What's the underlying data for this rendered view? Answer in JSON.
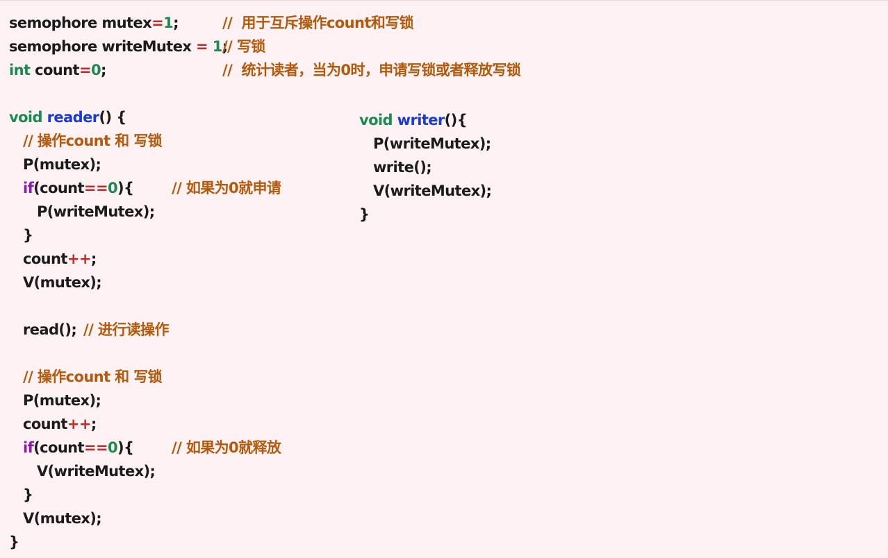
{
  "code": {
    "decl": {
      "mutex": {
        "type": "semophore",
        "name": "mutex",
        "op": "=",
        "value": "1",
        "end": ";",
        "comment": "//  用于互斥操作count和写锁"
      },
      "write_mutex": {
        "type": "semophore",
        "name": "writeMutex",
        "op": " = ",
        "value": "1",
        "end": ";",
        "comment": "// 写锁"
      },
      "count": {
        "type": "int",
        "name": "count",
        "op": "=",
        "value": "0",
        "end": ";",
        "comment": "//  统计读者，当为0时，申请写锁或者释放写锁"
      }
    },
    "reader": {
      "keyword": "void",
      "name": "reader",
      "signature_end": "() {",
      "comment_lock_1": "// 操作count 和 写锁",
      "p_mutex_1": "P(mutex);",
      "if_1": {
        "keyword": "if",
        "open": "(count",
        "op": "==",
        "value": "0",
        "close": "){",
        "comment": "// 如果为0就申请"
      },
      "p_write_mutex": "P(writeMutex);",
      "close_brace_1": "}",
      "count_inc_1": {
        "name": "count",
        "op": "++",
        "end": ";"
      },
      "v_mutex_1": "V(mutex);",
      "read_call": "read();",
      "read_comment": "// 进行读操作",
      "comment_lock_2": "// 操作count 和 写锁",
      "p_mutex_2": "P(mutex);",
      "count_inc_2": {
        "name": "count",
        "op": "++",
        "end": ";"
      },
      "if_2": {
        "keyword": "if",
        "open": "(count",
        "op": "==",
        "value": "0",
        "close": "){",
        "comment": "// 如果为0就释放"
      },
      "v_write_mutex": "V(writeMutex);",
      "close_brace_2": "}",
      "v_mutex_2": "V(mutex);",
      "end_brace": "}"
    },
    "writer": {
      "keyword": "void",
      "name": "writer",
      "signature_end": "(){",
      "p_write_mutex": "P(writeMutex);",
      "write_call": "write();",
      "v_write_mutex": "V(writeMutex);",
      "end_brace": "}"
    }
  },
  "colors": {
    "background": "#fcf1f3",
    "text": "#1b1b1b",
    "comment": "#b4590a",
    "type_keyword": "#1a8a52",
    "function_name": "#1a3ad4",
    "control_keyword": "#8a1fa6",
    "operator": "#c22a2a",
    "number": "#1a8a52"
  }
}
